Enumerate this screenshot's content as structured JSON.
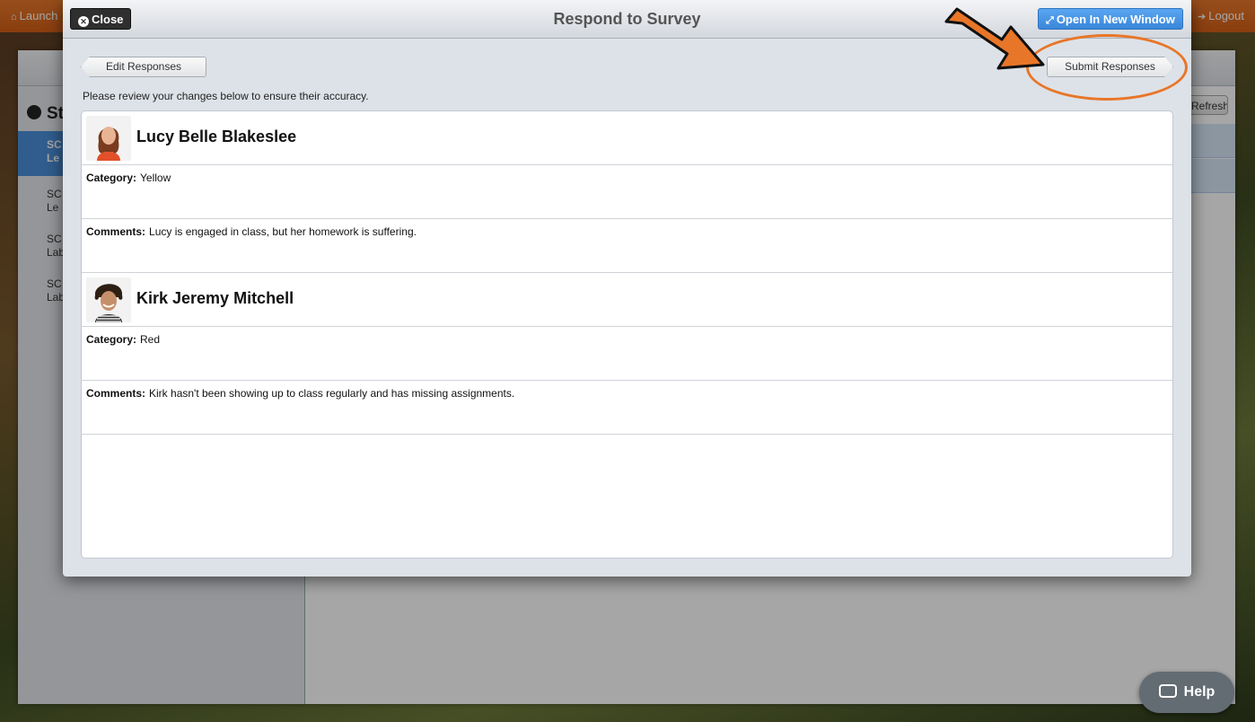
{
  "topbar": {
    "left_label": "Launch",
    "right_label": "Logout"
  },
  "background": {
    "sidebar_title": "St",
    "items": [
      {
        "line1": "SC",
        "line2": "Le"
      },
      {
        "line1": "SC",
        "line2": "Le"
      },
      {
        "line1": "SC",
        "line2": "Lab"
      },
      {
        "line1": "SC",
        "line2": "Lab"
      }
    ],
    "refresh_label": "Refresh"
  },
  "modal": {
    "close_label": "Close",
    "title": "Respond to Survey",
    "open_new_window_label": "Open In New Window",
    "edit_responses_label": "Edit Responses",
    "submit_responses_label": "Submit Responses",
    "instructions": "Please review your changes below to ensure their accuracy."
  },
  "responses": [
    {
      "name": "Lucy Belle Blakeslee",
      "category_label": "Category:",
      "category": "Yellow",
      "comments_label": "Comments:",
      "comments": "Lucy is engaged in class, but her homework is suffering."
    },
    {
      "name": "Kirk Jeremy Mitchell",
      "category_label": "Category:",
      "category": "Red",
      "comments_label": "Comments:",
      "comments": "Kirk hasn't been showing up to class regularly and has missing assignments."
    }
  ],
  "help": {
    "label": "Help"
  },
  "colors": {
    "accent_orange": "#e87628",
    "primary_blue": "#3a86d9",
    "topbar_orange": "#e26e22"
  }
}
